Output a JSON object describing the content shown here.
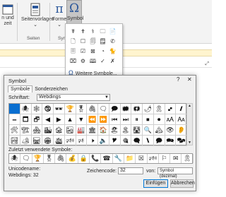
{
  "ribbon": {
    "left_button_lines": [
      "n und",
      "zeit"
    ],
    "page_templates_label": "Seitenvorlagen",
    "pages_group_label": "Seiten",
    "formula_label": "Formel",
    "symbol_label": "Symbol",
    "symbols_group_label": "Symb"
  },
  "dropdown": {
    "symbols": [
      "☤",
      "✝",
      "⚕",
      "🗀",
      "📄",
      "🗋",
      "☐",
      "🗐",
      "🗒",
      "✆",
      "🗏",
      "☑",
      "⊠",
      "◔",
      "🐈",
      "⌧",
      "⚙",
      "🕮",
      "✓",
      "✗"
    ],
    "more_label": "Weitere Symbole..."
  },
  "dialog": {
    "title": "Symbol",
    "help": "?",
    "close": "✕",
    "tab_symbols": "Symbole",
    "tab_special": "Sonderzeichen",
    "font_label": "Schriftart:",
    "font_value": "Webdings",
    "grid_symbols": [
      "",
      "🕷",
      "🕸",
      "🕲",
      "🕶",
      "🏆",
      "🎖",
      "🖇",
      "🗨",
      "🗩",
      "🗰",
      "🗱",
      "🌶",
      "🎗",
      "🙾",
      "🙼",
      "🗕",
      "🗖",
      "🗗",
      "◀",
      "▶",
      "▲",
      "▼",
      "⏪",
      "⏩",
      "⏮",
      "⏭",
      "⏸",
      "⏹",
      "⏺",
      "🗚",
      "🗛",
      "🛠",
      "🏗",
      "🏘",
      "🏙",
      "🏚",
      "🏜",
      "🏭",
      "🏛",
      "🏠",
      "🏖",
      "🏝",
      "🛣",
      "🔍",
      "🏔",
      "👁",
      "👂",
      "🏞",
      "🏕",
      "🛤",
      "🏟",
      "🛳",
      "🕬",
      "🕫",
      "🕨",
      "🔈",
      "🎔",
      "🎕",
      "🗬",
      "🙽",
      "🗭",
      "🗪",
      "🗫"
    ],
    "recent_label": "Zuletzt verwendete Symbole:",
    "recent_symbols": [
      "🕷",
      "🗨",
      "🏆",
      "🎖",
      "🖇",
      "💰",
      "🔒",
      "📞",
      "☎",
      "🔧",
      "📁",
      "☒",
      "🕬",
      "⚐",
      "✉",
      "🎗"
    ],
    "unicode_name_label": "Unicodename:",
    "unicode_name_value": "Webdings: 32",
    "char_code_label": "Zeichencode:",
    "char_code_value": "32",
    "from_label": "von:",
    "from_value": "Symbol (dezimal)",
    "insert_label": "Einfügen",
    "cancel_label": "Abbrechen"
  }
}
